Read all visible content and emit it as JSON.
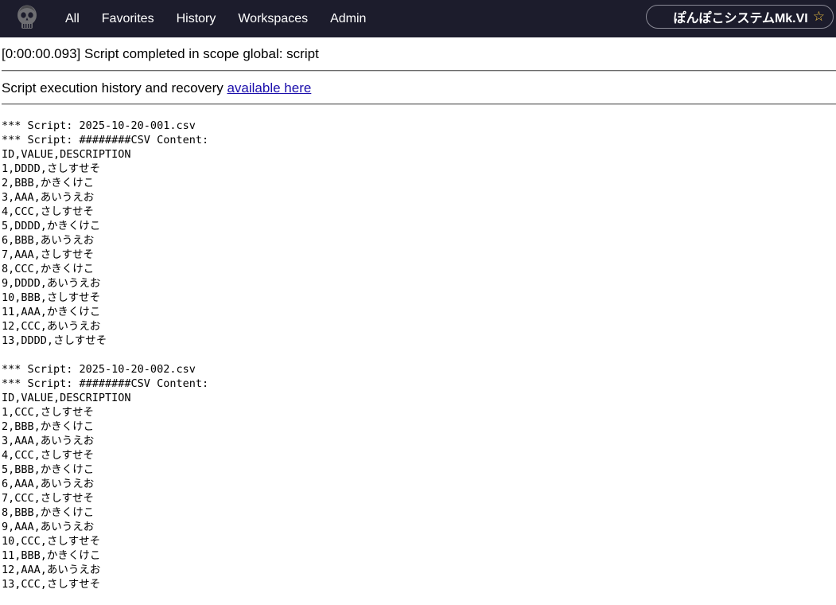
{
  "navbar": {
    "logo_icon": "skull-logo-icon",
    "links": [
      "All",
      "Favorites",
      "History",
      "Workspaces",
      "Admin"
    ],
    "system_name": "ぽんぽこシステムMk.VI",
    "star_icon": "☆",
    "background": "#1c1c2c",
    "star_color": "#f5c542"
  },
  "status": {
    "message": "[0:00:00.093] Script completed in scope global: script"
  },
  "history": {
    "text": "Script execution history and recovery ",
    "link_label": "available here",
    "link_color": "#1a0dab"
  },
  "output": {
    "text": "*** Script: 2025-10-20-001.csv\n*** Script: ########CSV Content:\nID,VALUE,DESCRIPTION\n1,DDDD,さしすせそ\n2,BBB,かきくけこ\n3,AAA,あいうえお\n4,CCC,さしすせそ\n5,DDDD,かきくけこ\n6,BBB,あいうえお\n7,AAA,さしすせそ\n8,CCC,かきくけこ\n9,DDDD,あいうえお\n10,BBB,さしすせそ\n11,AAA,かきくけこ\n12,CCC,あいうえお\n13,DDDD,さしすせそ\n\n*** Script: 2025-10-20-002.csv\n*** Script: ########CSV Content:\nID,VALUE,DESCRIPTION\n1,CCC,さしすせそ\n2,BBB,かきくけこ\n3,AAA,あいうえお\n4,CCC,さしすせそ\n5,BBB,かきくけこ\n6,AAA,あいうえお\n7,CCC,さしすせそ\n8,BBB,かきくけこ\n9,AAA,あいうえお\n10,CCC,さしすせそ\n11,BBB,かきくけこ\n12,AAA,あいうえお\n13,CCC,さしすせそ"
  }
}
